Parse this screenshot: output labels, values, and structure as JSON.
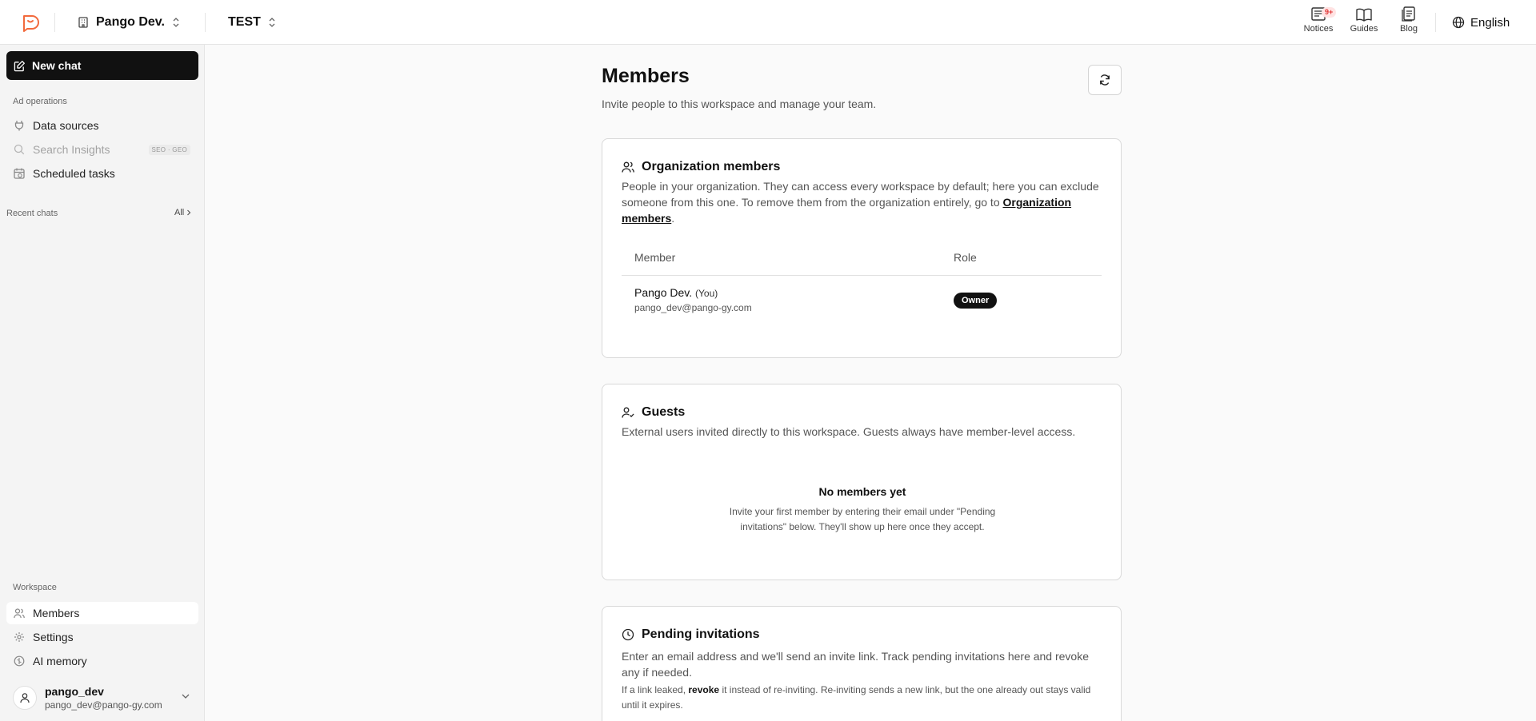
{
  "topbar": {
    "workspace_name": "Pango Dev.",
    "project_name": "TEST",
    "notices_label": "Notices",
    "notices_badge": "9+",
    "guides_label": "Guides",
    "blog_label": "Blog",
    "language": "English"
  },
  "sidebar": {
    "new_chat": "New chat",
    "ad_ops_label": "Ad operations",
    "items": [
      {
        "label": "Data sources"
      },
      {
        "label": "Search Insights",
        "tag": "SEO · GEO"
      },
      {
        "label": "Scheduled tasks"
      }
    ],
    "recent_label": "Recent chats",
    "recent_all": "All",
    "workspace_label": "Workspace",
    "workspace_items": [
      {
        "label": "Members"
      },
      {
        "label": "Settings"
      },
      {
        "label": "AI memory"
      }
    ],
    "user": {
      "name": "pango_dev",
      "email": "pango_dev@pango-gy.com"
    }
  },
  "main": {
    "title": "Members",
    "subtitle": "Invite people to this workspace and manage your team.",
    "org": {
      "title": "Organization members",
      "desc": "People in your organization. They can access every workspace by default; here you can exclude someone from this one. To remove them from the organization entirely, go to",
      "link": "Organization members",
      "desc_end": ".",
      "col_member": "Member",
      "col_role": "Role",
      "rows": [
        {
          "name": "Pango Dev.",
          "you": "(You)",
          "email": "pango_dev@pango-gy.com",
          "role": "Owner"
        }
      ]
    },
    "guests": {
      "title": "Guests",
      "desc": "External users invited directly to this workspace. Guests always have member-level access.",
      "empty_title": "No members yet",
      "empty_desc": "Invite your first member by entering their email under \"Pending invitations\" below. They'll show up here once they accept."
    },
    "pending": {
      "title": "Pending invitations",
      "desc": "Enter an email address and we'll send an invite link. Track pending invitations here and revoke any if needed.",
      "note_pre": "If a link leaked,",
      "note_bold": "revoke",
      "note_post": "it instead of re-inviting. Re-inviting sends a new link, but the one already out stays valid until it expires."
    }
  }
}
